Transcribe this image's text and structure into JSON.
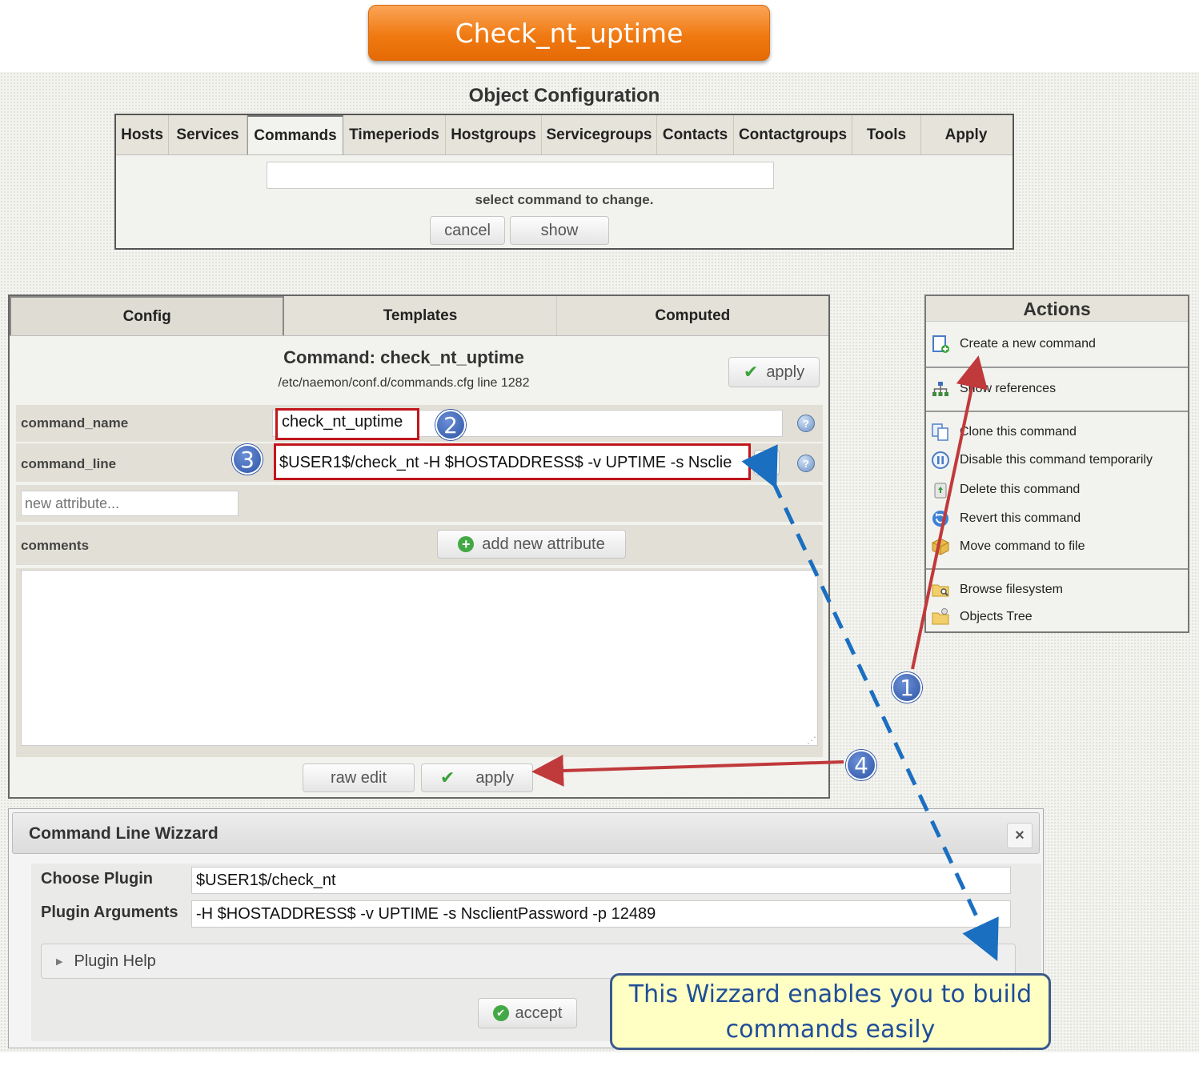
{
  "banner": {
    "title": "Check_nt_uptime"
  },
  "object_configuration": {
    "title": "Object Configuration",
    "nav_tabs": [
      "Hosts",
      "Services",
      "Commands",
      "Timeperiods",
      "Hostgroups",
      "Servicegroups",
      "Contacts",
      "Contactgroups",
      "Tools",
      "Apply"
    ],
    "active_tab": "Commands",
    "select_input_value": "",
    "select_hint": "select command to change.",
    "cancel_label": "cancel",
    "show_label": "show"
  },
  "editor": {
    "tabs": [
      "Config",
      "Templates",
      "Computed"
    ],
    "active_tab": "Config",
    "title": "Command: check_nt_uptime",
    "path": "/etc/naemon/conf.d/commands.cfg line 1282",
    "apply_top_label": "apply",
    "command_name_label": "command_name",
    "command_name_value": "check_nt_uptime",
    "command_line_label": "command_line",
    "command_line_value": "$USER1$/check_nt -H $HOSTADDRESS$ -v UPTIME -s Nsclie",
    "new_attribute_placeholder": "new attribute...",
    "comments_label": "comments",
    "add_attribute_label": "add new attribute",
    "comments_value": "",
    "raw_edit_label": "raw edit",
    "apply_bottom_label": "apply",
    "help_glyph": "?"
  },
  "actions": {
    "title": "Actions",
    "items": [
      {
        "label": "Create a new command",
        "icon": "new-document-icon",
        "color": "#4a7cc4"
      },
      {
        "label": "Show references",
        "icon": "sitemap-icon",
        "color": "#3f8a3f"
      },
      {
        "label": "Clone this command",
        "icon": "copy-icon",
        "color": "#5b88c9"
      },
      {
        "label": "Disable this command temporarily",
        "icon": "pause-icon",
        "color": "#4a7cc4"
      },
      {
        "label": "Delete this command",
        "icon": "recycle-icon",
        "color": "#3a9a3a"
      },
      {
        "label": "Revert this command",
        "icon": "revert-icon",
        "color": "#3b82d6"
      },
      {
        "label": "Move command to file",
        "icon": "package-icon",
        "color": "#d6a32f"
      },
      {
        "label": "Browse filesystem",
        "icon": "folder-search-icon",
        "color": "#e0b64a"
      },
      {
        "label": "Objects Tree",
        "icon": "folder-tree-icon",
        "color": "#e0b64a"
      }
    ]
  },
  "wizard": {
    "title": "Command Line Wizzard",
    "close_glyph": "×",
    "choose_plugin_label": "Choose Plugin",
    "choose_plugin_value": "$USER1$/check_nt",
    "plugin_arguments_label": "Plugin Arguments",
    "plugin_arguments_value": "-H $HOSTADDRESS$ -v UPTIME -s NsclientPassword -p 12489",
    "plugin_help_label": "Plugin Help",
    "accept_label": "accept"
  },
  "annotations": {
    "badges": [
      "1",
      "2",
      "3",
      "4"
    ],
    "callout_line1": "This Wizzard enables you to build",
    "callout_line2": "commands easily",
    "arrow_red": "#c0393b",
    "arrow_blue": "#1b6fc1"
  },
  "colors": {
    "banner": "#f07a12",
    "apply_check": "#3aa33a"
  }
}
